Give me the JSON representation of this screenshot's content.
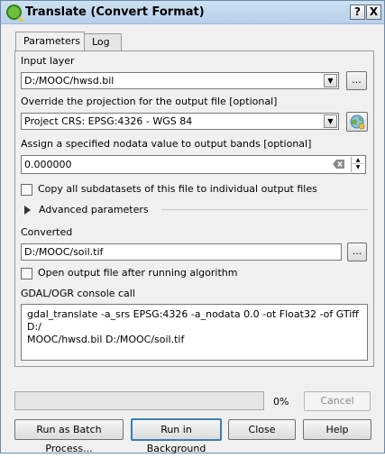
{
  "window": {
    "title": "Translate (Convert Format)",
    "help_button": "?",
    "close_button": "X"
  },
  "tabs": [
    {
      "label": "Parameters",
      "active": true
    },
    {
      "label": "Log",
      "active": false
    }
  ],
  "form": {
    "input_layer": {
      "label": "Input layer",
      "value": "D:/MOOC/hwsd.bil",
      "browse": "..."
    },
    "override_projection": {
      "label": "Override the projection for the output file [optional]",
      "value": "Project CRS: EPSG:4326 - WGS 84"
    },
    "nodata": {
      "label": "Assign a specified nodata value to output bands [optional]",
      "value": "0.000000"
    },
    "copy_subdatasets": {
      "label": "Copy all subdatasets of this file to individual output files",
      "checked": false
    },
    "advanced": {
      "label": "Advanced parameters",
      "expanded": false
    },
    "converted": {
      "label": "Converted",
      "value": "D:/MOOC/soil.tif",
      "browse": "..."
    },
    "open_output": {
      "label": "Open output file after running algorithm",
      "checked": false
    },
    "console": {
      "label": "GDAL/OGR console call",
      "line1": "gdal_translate -a_srs EPSG:4326 -a_nodata 0.0 -ot Float32 -of GTiff D:/",
      "line2": "MOOC/hwsd.bil D:/MOOC/soil.tif"
    }
  },
  "progress": {
    "percent_label": "0%",
    "value": 0
  },
  "buttons": {
    "cancel": "Cancel",
    "batch": "Run as Batch Process...",
    "background": "Run in Background",
    "close": "Close",
    "help": "Help"
  },
  "colors": {
    "title_bar": "#b7d0ea",
    "window_bg": "#f0f0f0",
    "accent_border": "#3c7fb1"
  }
}
